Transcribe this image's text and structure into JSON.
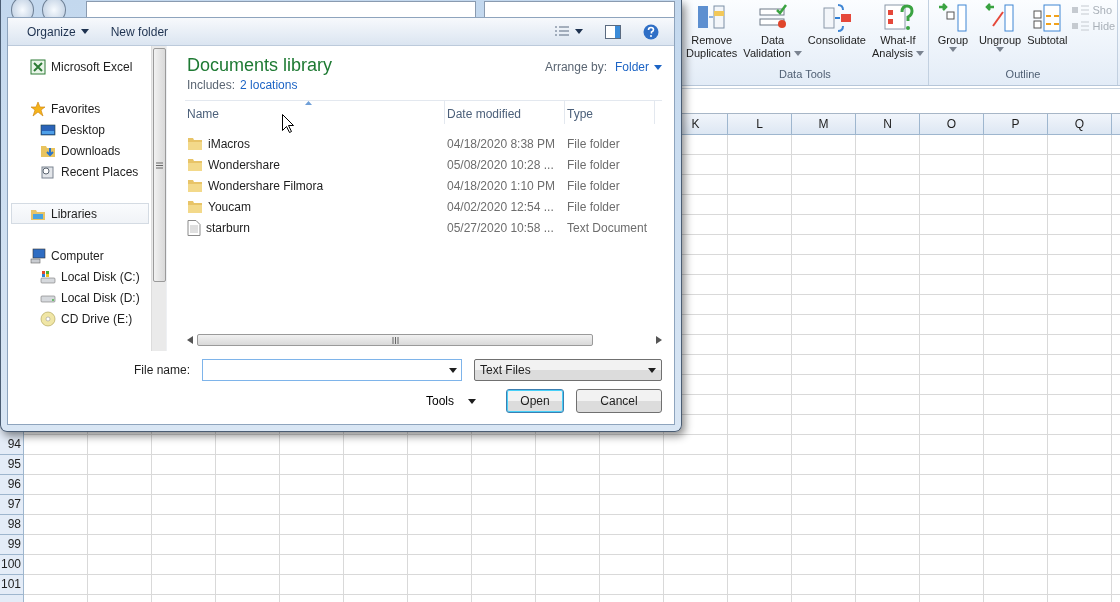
{
  "excel": {
    "ribbon": [
      {
        "label": "Data Tools",
        "commands": [
          {
            "kind": "remove-duplicates",
            "lines": [
              "Remove",
              "Duplicates"
            ],
            "dropdown": false
          },
          {
            "kind": "validation",
            "lines": [
              "Data",
              "Validation"
            ],
            "dropdown": true
          },
          {
            "kind": "consolidate",
            "lines": [
              "Consolidate"
            ],
            "dropdown": false
          },
          {
            "kind": "what-if",
            "lines": [
              "What-If",
              "Analysis"
            ],
            "dropdown": true
          }
        ]
      },
      {
        "label": "Outline",
        "commands": [
          {
            "kind": "group",
            "lines": [
              "Group"
            ],
            "dropdown": true
          },
          {
            "kind": "ungroup",
            "lines": [
              "Ungroup"
            ],
            "dropdown": true
          },
          {
            "kind": "subtotal",
            "lines": [
              "Subtotal"
            ],
            "dropdown": false
          }
        ],
        "small_commands": [
          {
            "label": "Sho",
            "disabled": true
          },
          {
            "label": "Hide",
            "disabled": true
          }
        ]
      }
    ],
    "columns": [
      "K",
      "L",
      "M",
      "N",
      "O",
      "P",
      "Q"
    ],
    "rows": [
      "94",
      "95",
      "96",
      "97",
      "98",
      "99",
      "100",
      "101"
    ]
  },
  "dialog": {
    "toolbar": [
      {
        "label": "Organize",
        "kind": "menu"
      },
      {
        "label": "New folder",
        "kind": "button"
      }
    ],
    "navigation": [
      {
        "label": "Microsoft Excel",
        "kind": "excel",
        "selected": false
      },
      {
        "label": "Favorites",
        "kind": "star",
        "selected": false,
        "children": [
          {
            "label": "Desktop",
            "kind": "desktop",
            "selected": false
          },
          {
            "label": "Downloads",
            "kind": "downloads",
            "selected": false
          },
          {
            "label": "Recent Places",
            "kind": "recent",
            "selected": false
          }
        ]
      },
      {
        "label": "Libraries",
        "kind": "library",
        "selected": true
      },
      {
        "label": "Computer",
        "kind": "computer",
        "selected": false,
        "children": [
          {
            "label": "Local Disk (C:)",
            "kind": "system-disk",
            "selected": false
          },
          {
            "label": "Local Disk (D:)",
            "kind": "disk",
            "selected": false
          },
          {
            "label": "CD Drive (E:)",
            "kind": "cd",
            "selected": false
          }
        ]
      }
    ],
    "library": {
      "title": "Documents library",
      "includes_label": "Includes:",
      "includes_link": "2 locations",
      "arrange_label": "Arrange by:",
      "arrange_value": "Folder"
    },
    "columns": [
      {
        "label": "Name",
        "sorted": true
      },
      {
        "label": "Date modified",
        "sorted": false
      },
      {
        "label": "Type",
        "sorted": false
      }
    ],
    "files": [
      {
        "name": "iMacros",
        "date": "04/18/2020 8:38 PM",
        "type": "File folder",
        "kind": "folder"
      },
      {
        "name": "Wondershare",
        "date": "05/08/2020 10:28 ...",
        "type": "File folder",
        "kind": "folder"
      },
      {
        "name": "Wondershare Filmora",
        "date": "04/18/2020 1:10 PM",
        "type": "File folder",
        "kind": "folder"
      },
      {
        "name": "Youcam",
        "date": "04/02/2020 12:54 ...",
        "type": "File folder",
        "kind": "folder"
      },
      {
        "name": "starburn",
        "date": "05/27/2020 10:58 ...",
        "type": "Text Document",
        "kind": "document"
      }
    ],
    "file_name": {
      "label": "File name:"
    },
    "file_type": "Text Files",
    "tools": "Tools",
    "buttons": [
      {
        "label": "Open",
        "default": true
      },
      {
        "label": "Cancel",
        "default": false
      }
    ]
  }
}
